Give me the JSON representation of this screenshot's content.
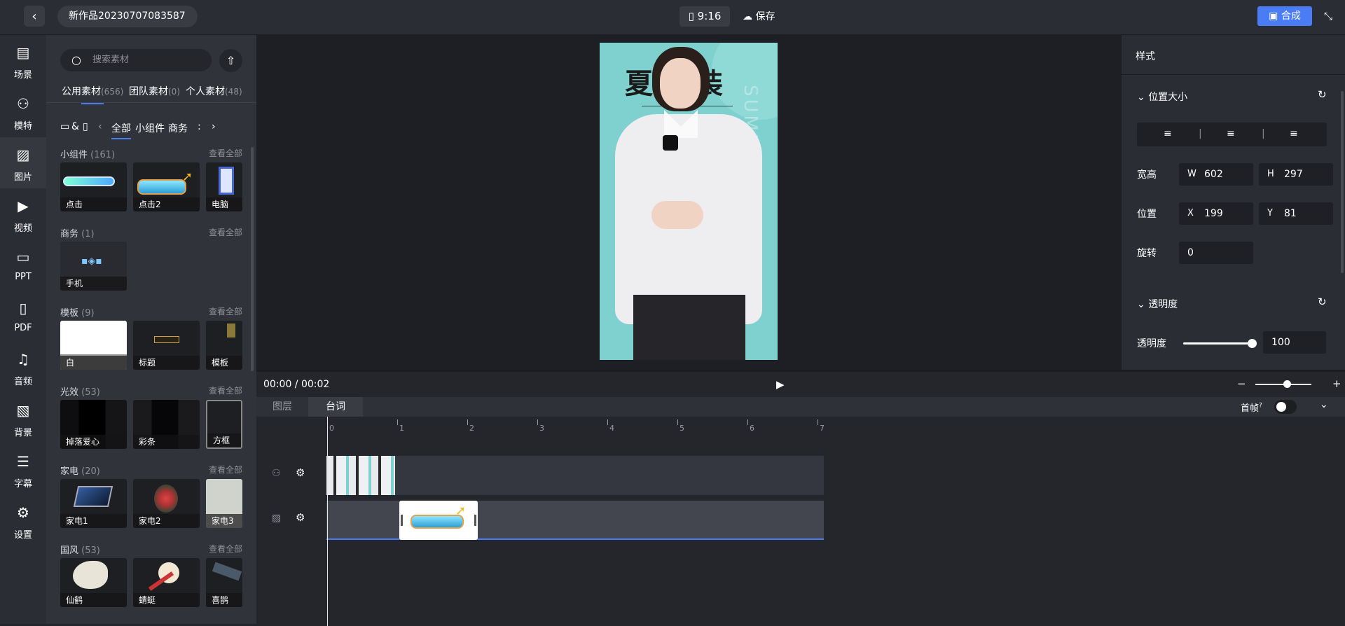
{
  "header": {
    "back_icon": "chevron-left-icon",
    "project_title": "新作品20230707083587",
    "aspect_ratio": "9:16",
    "save_label": "保存",
    "compose_label": "合成"
  },
  "nav": {
    "items": [
      {
        "label": "场景",
        "icon": "scene-icon"
      },
      {
        "label": "模特",
        "icon": "model-icon"
      },
      {
        "label": "图片",
        "icon": "image-icon"
      },
      {
        "label": "视频",
        "icon": "video-icon"
      },
      {
        "label": "PPT",
        "icon": "ppt-icon"
      },
      {
        "label": "PDF",
        "icon": "pdf-icon"
      },
      {
        "label": "音频",
        "icon": "audio-icon"
      },
      {
        "label": "背景",
        "icon": "background-icon"
      },
      {
        "label": "字幕",
        "icon": "subtitle-icon"
      },
      {
        "label": "设置",
        "icon": "settings-icon"
      }
    ],
    "active_index": 2
  },
  "library": {
    "search_placeholder": "搜索素材",
    "source_tabs": [
      {
        "label": "公用素材",
        "count": "(656)"
      },
      {
        "label": "团队素材",
        "count": "(0)"
      },
      {
        "label": "个人素材",
        "count": "(48)"
      }
    ],
    "device_filter": "&",
    "categories": [
      "全部",
      "小组件",
      "商务"
    ],
    "view_all_label": "查看全部",
    "sections": [
      {
        "title": "小组件",
        "count": "(161)",
        "items": [
          "点击",
          "点击2",
          "电脑"
        ]
      },
      {
        "title": "商务",
        "count": "(1)",
        "items": [
          "手机"
        ]
      },
      {
        "title": "模板",
        "count": "(9)",
        "items": [
          "白",
          "标题",
          "模板"
        ]
      },
      {
        "title": "光效",
        "count": "(53)",
        "items": [
          "掉落爱心",
          "彩条",
          "方框"
        ]
      },
      {
        "title": "家电",
        "count": "(20)",
        "items": [
          "家电1",
          "家电2",
          "家电3"
        ]
      },
      {
        "title": "国风",
        "count": "(53)",
        "items": [
          "仙鹤",
          "蜻蜓",
          "喜鹊"
        ]
      }
    ]
  },
  "canvas": {
    "poster_text": "夏 女装",
    "poster_side_text": "SUMMER CLOTHES"
  },
  "properties": {
    "title": "样式",
    "position_group_title": "位置大小",
    "size_label": "宽高",
    "w_key": "W",
    "w_value": "602",
    "h_key": "H",
    "h_value": "297",
    "position_label": "位置",
    "x_key": "X",
    "x_value": "199",
    "y_key": "Y",
    "y_value": "81",
    "rotation_label": "旋转",
    "rotation_value": "0",
    "opacity_group_title": "透明度",
    "opacity_label": "透明度",
    "opacity_value": "100",
    "opacity_level": 1.0
  },
  "timeline": {
    "time_display": "00:00 / 00:02",
    "tabs": [
      "图层",
      "台词"
    ],
    "active_tab": 1,
    "first_frame_label": "首帧",
    "ruler_marks": [
      "0",
      "1",
      "2",
      "3",
      "4",
      "5",
      "6",
      "7"
    ],
    "zoom_level": 0.5
  },
  "colors": {
    "accent": "#4a7cf6",
    "poster_bg": "#7fd1cf"
  }
}
